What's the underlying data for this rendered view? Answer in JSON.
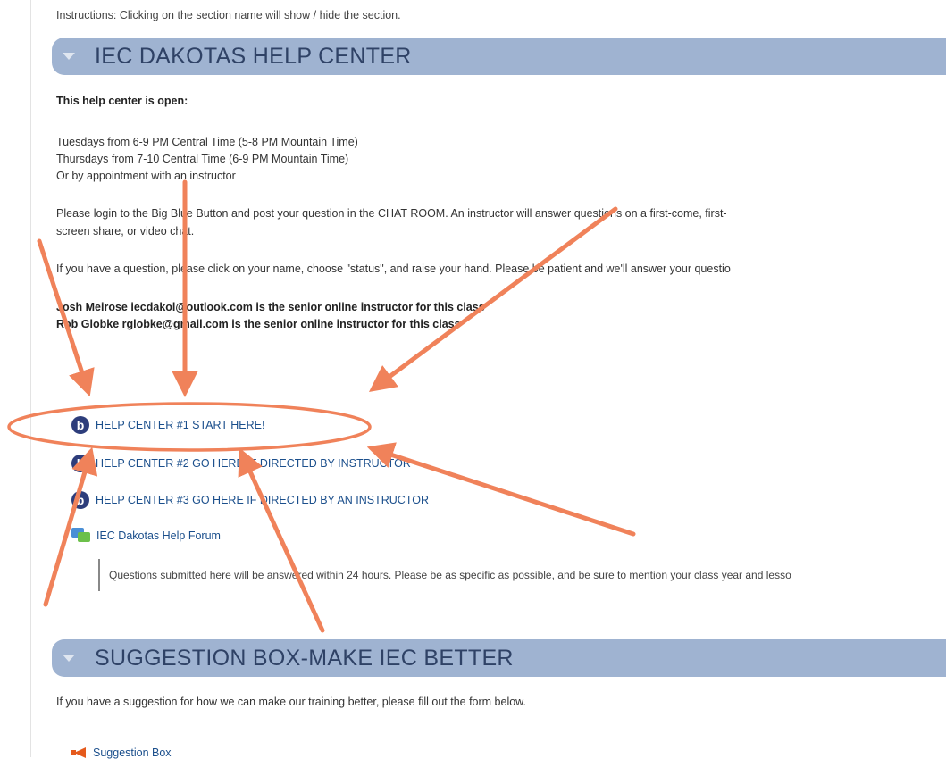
{
  "instructions": "Instructions: Clicking on the section name will show / hide the section.",
  "section1": {
    "title": "IEC DAKOTAS HELP CENTER",
    "open_heading": "This help center is open:",
    "hours": [
      "Tuesdays from 6-9 PM Central Time (5-8 PM Mountain Time)",
      "Thursdays from 7-10 Central Time (6-9 PM Mountain Time)",
      "Or by appointment with an instructor"
    ],
    "login_line1": "Please login to the Big Blue Button and post your question in the CHAT ROOM.   An instructor will answer questions on a first-come, first-",
    "login_line2": "screen share, or video chat.",
    "question_line": "If you have a question, please click on your  name, choose \"status\", and raise your hand.  Please be patient and we'll answer your questio",
    "instructors": [
      "Josh Meirose  iecdakol@outlook.com  is the senior online instructor for this class",
      "Rob Globke    rglobke@gmail.com is the senior online  instructor for this class"
    ],
    "activities": [
      "HELP CENTER #1 START HERE!",
      "HELP CENTER #2 GO HERE IF DIRECTED BY INSTRUCTOR",
      "HELP CENTER #3 GO HERE IF DIRECTED BY AN INSTRUCTOR"
    ],
    "forum": {
      "label": "IEC Dakotas Help Forum",
      "description": "Questions submitted here will be answered within 24 hours. Please be as specific as possible, and be sure to mention your class year and lesso"
    }
  },
  "section2": {
    "title": "SUGGESTION BOX-MAKE IEC BETTER",
    "description": "If you have a suggestion for how we can make our training better, please fill out the form below.",
    "link": "Suggestion Box"
  },
  "annotation_colors": {
    "arrow": "#f0825a",
    "section_bar": "#9fb3d1",
    "link": "#1b4f8c"
  },
  "icons": {
    "collapse": "triangle-down-icon",
    "bbb": "bigbluebutton-icon",
    "forum": "forum-icon",
    "suggestion": "megaphone-icon"
  }
}
